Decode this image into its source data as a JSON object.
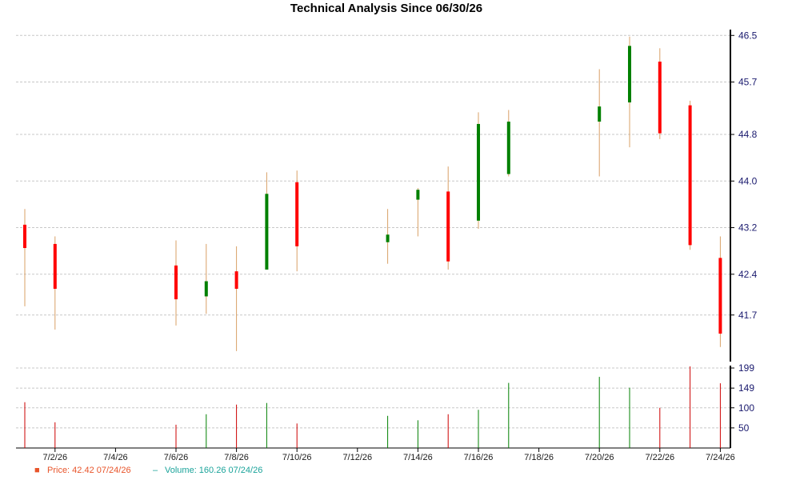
{
  "chart_data": {
    "type": "candlestick",
    "title": "Technical Analysis Since 06/30/26",
    "colors": {
      "up": "#008000",
      "down": "#ff0000",
      "wick": "#d9a066",
      "volume_up": "#008000",
      "volume_down": "#cc0000",
      "grid": "#c8c8c8",
      "axis": "#000000",
      "price_legend": "#e8542a",
      "volume_legend": "#1aa39a",
      "y_tick": "#1a1a6e"
    },
    "price_axis": {
      "ylim": [
        40.9,
        46.6
      ],
      "ticks": [
        41.7,
        42.4,
        43.2,
        44.0,
        44.8,
        45.7,
        46.5
      ],
      "tick_labels": [
        "41.7",
        "42.4",
        "43.2",
        "44.0",
        "44.8",
        "45.7",
        "46.5"
      ],
      "grid": true,
      "position": "right"
    },
    "volume_axis": {
      "ylim": [
        0,
        205
      ],
      "ticks": [
        50,
        100,
        149,
        199
      ],
      "tick_labels": [
        "50",
        "100",
        "149",
        "199"
      ],
      "grid": true,
      "position": "right"
    },
    "x_axis": {
      "start": "2026-07-01",
      "end": "2026-07-24",
      "tick_dates": [
        "2026-07-02",
        "2026-07-04",
        "2026-07-06",
        "2026-07-08",
        "2026-07-10",
        "2026-07-12",
        "2026-07-14",
        "2026-07-16",
        "2026-07-18",
        "2026-07-20",
        "2026-07-22",
        "2026-07-24"
      ],
      "tick_labels": [
        "7/2/26",
        "7/4/26",
        "7/6/26",
        "7/8/26",
        "7/10/26",
        "7/12/26",
        "7/14/26",
        "7/16/26",
        "7/18/26",
        "7/20/26",
        "7/22/26",
        "7/24/26"
      ]
    },
    "candles": [
      {
        "date": "2026-07-01",
        "open": 43.25,
        "high": 43.52,
        "low": 41.85,
        "close": 42.85,
        "volume": 114
      },
      {
        "date": "2026-07-02",
        "open": 42.92,
        "high": 43.05,
        "low": 41.45,
        "close": 42.15,
        "volume": 64
      },
      {
        "date": "2026-07-06",
        "open": 42.55,
        "high": 42.98,
        "low": 41.52,
        "close": 41.97,
        "volume": 58
      },
      {
        "date": "2026-07-07",
        "open": 42.02,
        "high": 42.92,
        "low": 41.72,
        "close": 42.28,
        "volume": 84
      },
      {
        "date": "2026-07-08",
        "open": 42.45,
        "high": 42.88,
        "low": 41.08,
        "close": 42.15,
        "volume": 108
      },
      {
        "date": "2026-07-09",
        "open": 42.48,
        "high": 44.15,
        "low": 42.48,
        "close": 43.78,
        "volume": 112
      },
      {
        "date": "2026-07-10",
        "open": 43.98,
        "high": 44.18,
        "low": 42.45,
        "close": 42.88,
        "volume": 61
      },
      {
        "date": "2026-07-13",
        "open": 42.95,
        "high": 43.52,
        "low": 42.58,
        "close": 43.08,
        "volume": 80
      },
      {
        "date": "2026-07-14",
        "open": 43.68,
        "high": 43.88,
        "low": 43.05,
        "close": 43.85,
        "volume": 69
      },
      {
        "date": "2026-07-15",
        "open": 43.82,
        "high": 44.25,
        "low": 42.48,
        "close": 42.62,
        "volume": 84
      },
      {
        "date": "2026-07-16",
        "open": 43.32,
        "high": 45.18,
        "low": 43.18,
        "close": 44.98,
        "volume": 95
      },
      {
        "date": "2026-07-17",
        "open": 44.12,
        "high": 45.22,
        "low": 44.08,
        "close": 45.02,
        "volume": 162
      },
      {
        "date": "2026-07-20",
        "open": 45.02,
        "high": 45.92,
        "low": 44.08,
        "close": 45.28,
        "volume": 177
      },
      {
        "date": "2026-07-21",
        "open": 45.35,
        "high": 46.48,
        "low": 44.58,
        "close": 46.32,
        "volume": 150
      },
      {
        "date": "2026-07-22",
        "open": 46.05,
        "high": 46.28,
        "low": 44.72,
        "close": 44.82,
        "volume": 100
      },
      {
        "date": "2026-07-23",
        "open": 45.3,
        "high": 45.38,
        "low": 42.82,
        "close": 42.9,
        "volume": 203
      },
      {
        "date": "2026-07-24",
        "open": 42.68,
        "high": 43.05,
        "low": 41.15,
        "close": 41.38,
        "volume": 161
      }
    ],
    "legend": {
      "position": "bottom-left",
      "price_label": "Price: 42.42  07/24/26",
      "volume_label": "Volume: 160.26  07/24/26",
      "price_marker": "■",
      "volume_marker": "–"
    }
  }
}
